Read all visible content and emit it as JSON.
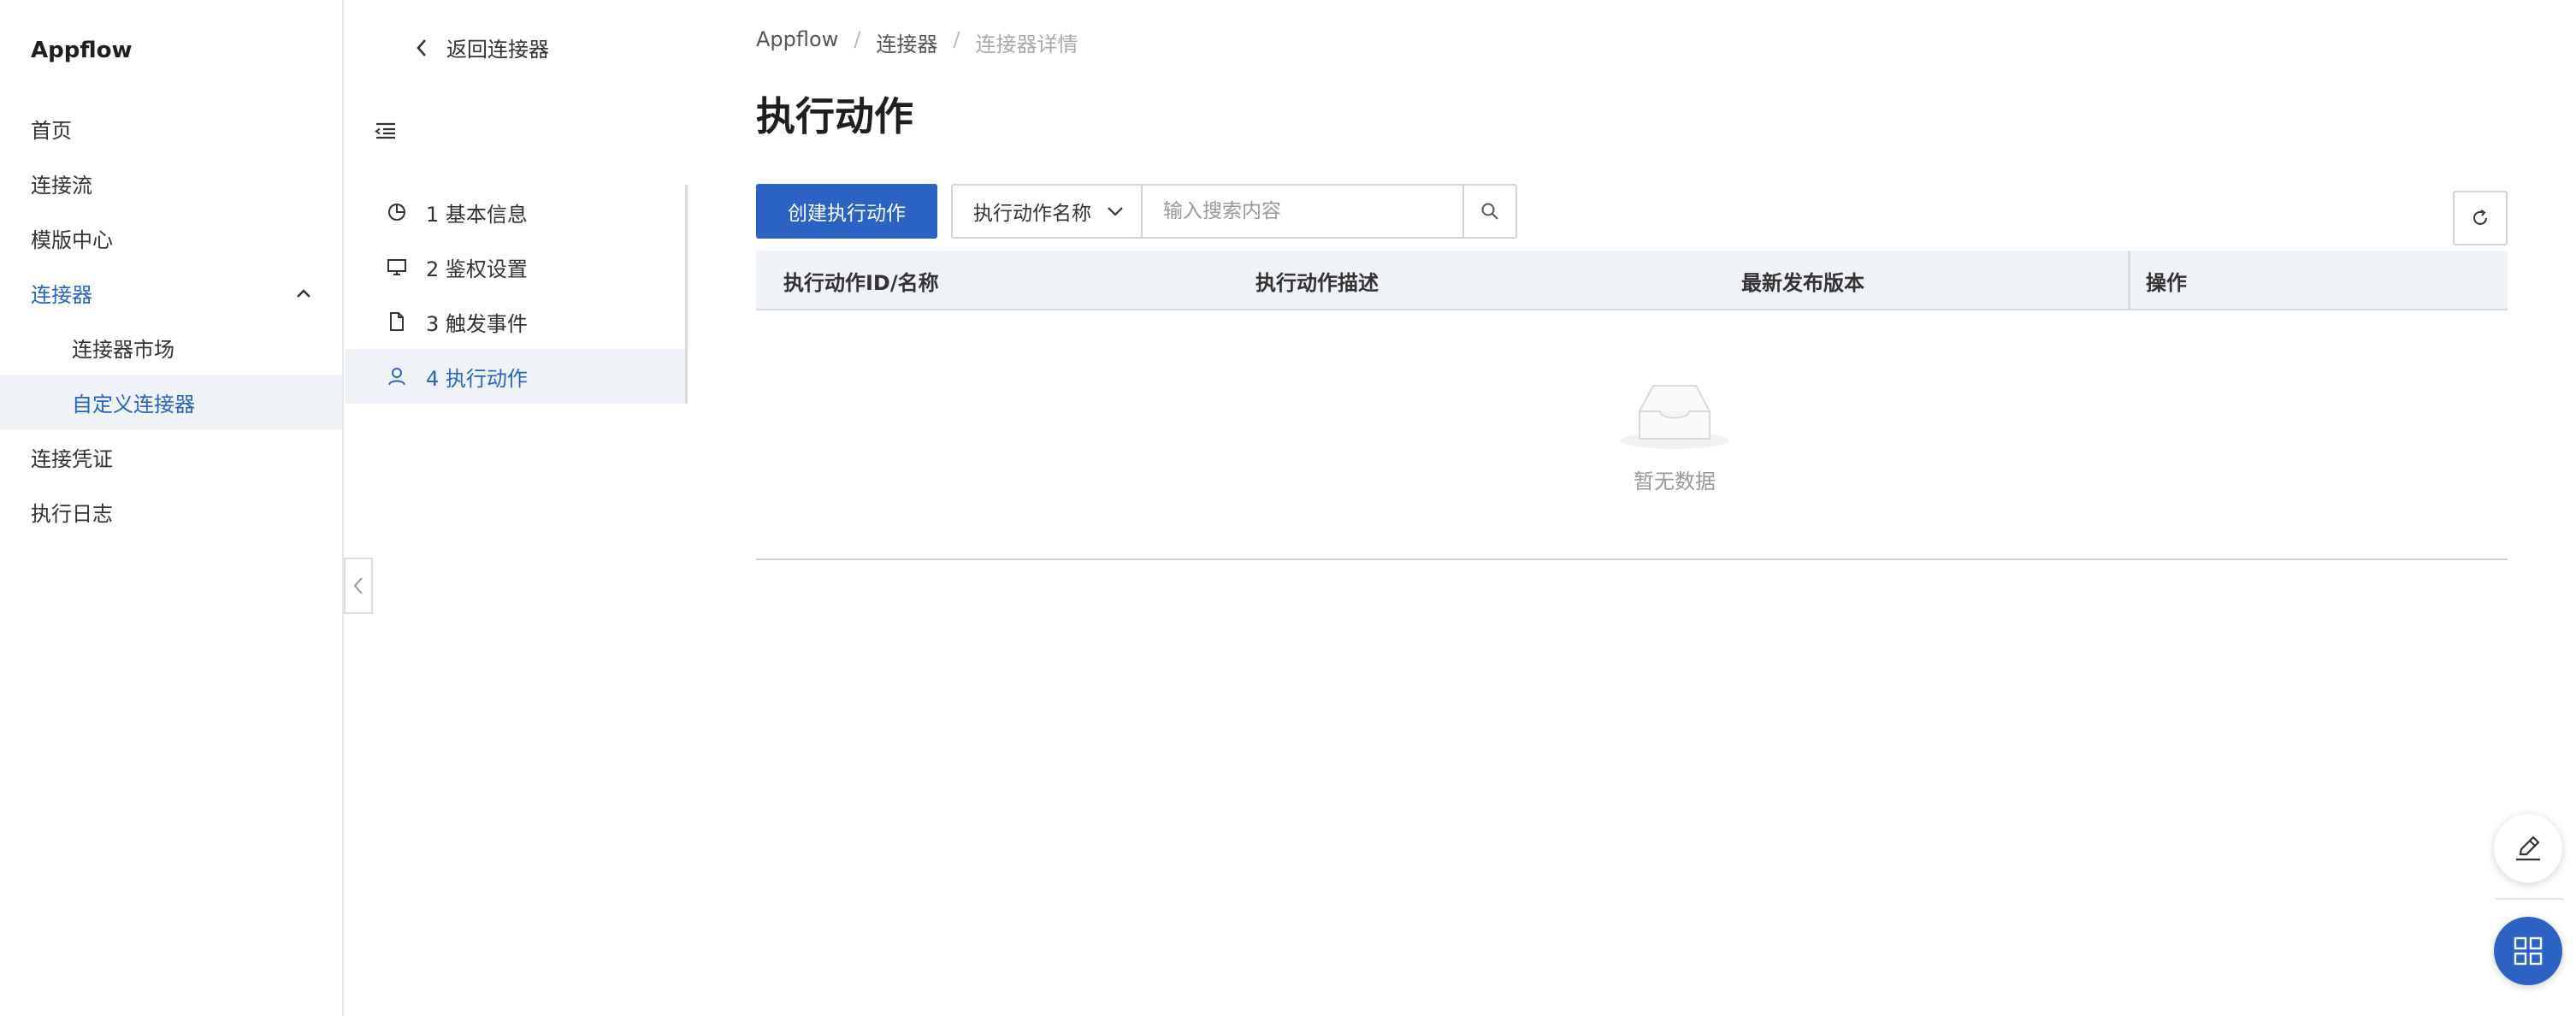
{
  "app": {
    "title": "Appflow"
  },
  "sidebar": {
    "items": [
      {
        "label": "首页"
      },
      {
        "label": "连接流"
      },
      {
        "label": "模版中心"
      },
      {
        "label": "连接器"
      },
      {
        "label": "连接器市场"
      },
      {
        "label": "自定义连接器"
      },
      {
        "label": "连接凭证"
      },
      {
        "label": "执行日志"
      }
    ]
  },
  "subpanel": {
    "back_label": "返回连接器",
    "steps": [
      {
        "label": "1 基本信息",
        "icon": "pie-chart-icon"
      },
      {
        "label": "2 鉴权设置",
        "icon": "monitor-icon"
      },
      {
        "label": "3 触发事件",
        "icon": "file-icon"
      },
      {
        "label": "4 执行动作",
        "icon": "user-icon"
      }
    ]
  },
  "breadcrumb": {
    "items": [
      "Appflow",
      "连接器",
      "连接器详情"
    ],
    "separator": "/"
  },
  "page": {
    "title": "执行动作"
  },
  "toolbar": {
    "create_label": "创建执行动作",
    "filter_selected": "执行动作名称",
    "search_placeholder": "输入搜索内容"
  },
  "table": {
    "columns": [
      "执行动作ID/名称",
      "执行动作描述",
      "最新发布版本",
      "操作"
    ],
    "empty_text": "暂无数据"
  },
  "colors": {
    "accent": "#2a63c3",
    "selected_bg": "#eff3f8"
  }
}
